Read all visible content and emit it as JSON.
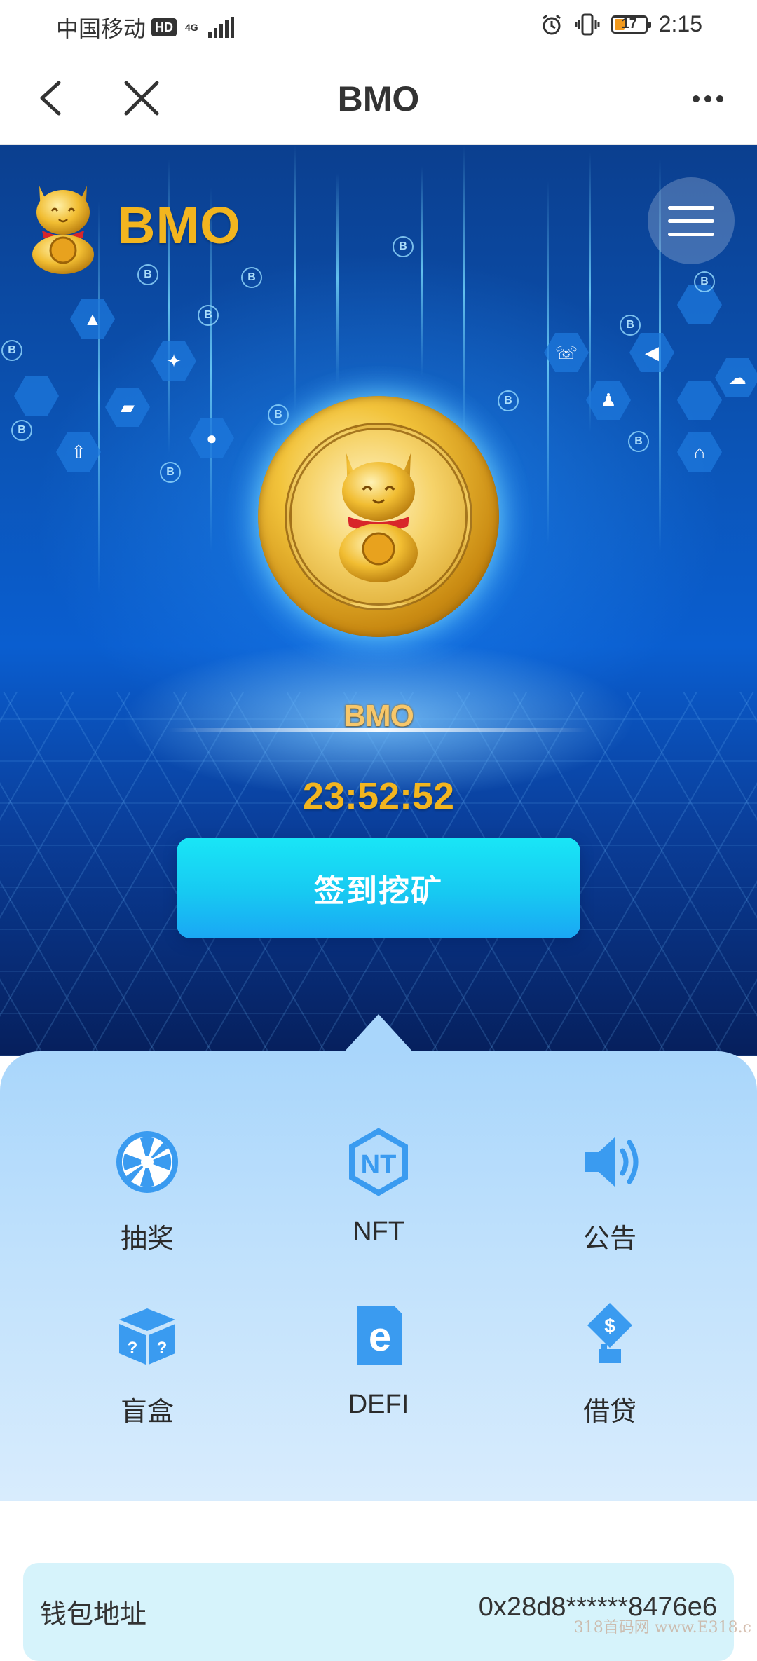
{
  "status_bar": {
    "carrier": "中国移动",
    "hd_badge": "HD",
    "network": "4G",
    "battery_level": "17",
    "time": "2:15"
  },
  "nav": {
    "title": "BMO",
    "icons": [
      "back-icon",
      "close-icon",
      "more-icon"
    ]
  },
  "hero": {
    "logo_text": "BMO",
    "brand_text": "BMO",
    "countdown": "23:52:52",
    "checkin_label": "签到挖矿",
    "accent_color": "#f2b51f",
    "button_color": "#17c9f2"
  },
  "menu": {
    "items": [
      {
        "label": "抽奖",
        "icon": "wheel-icon"
      },
      {
        "label": "NFT",
        "icon": "nft-icon"
      },
      {
        "label": "公告",
        "icon": "speaker-icon"
      },
      {
        "label": "盲盒",
        "icon": "mystery-box-icon"
      },
      {
        "label": "DEFI",
        "icon": "defi-icon"
      },
      {
        "label": "借贷",
        "icon": "loan-icon"
      }
    ],
    "icon_color": "#3a9bf0"
  },
  "wallet": {
    "label": "钱包地址",
    "address": "0x28d8******8476e6"
  },
  "watermark": "318首码网 www.E318.c"
}
